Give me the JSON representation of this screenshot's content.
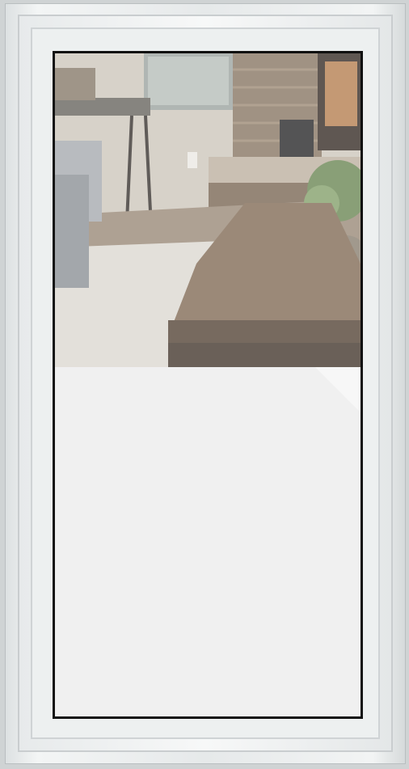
{
  "image": {
    "subject": "window",
    "colors": {
      "frame": "#e9ecec",
      "glass_frosted": "#f0f0f0",
      "glass_edge": "#111111",
      "floor": "#d8d6d0",
      "table_top": "#8a7560",
      "stone_wall": "#8b7a68",
      "sofa": "#9ea4ab"
    }
  }
}
